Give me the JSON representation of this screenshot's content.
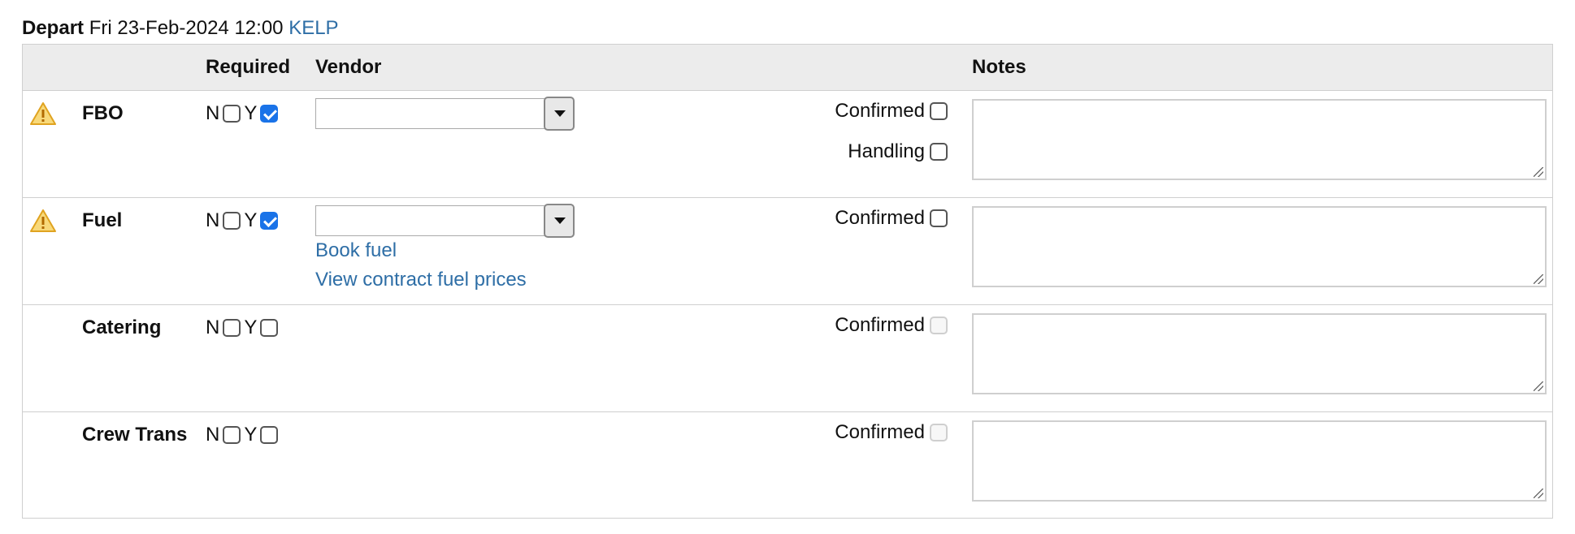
{
  "header": {
    "label": "Depart",
    "datetime": "Fri 23-Feb-2024 12:00",
    "airport": "KELP"
  },
  "columns": {
    "required": "Required",
    "vendor": "Vendor",
    "notes": "Notes"
  },
  "rows": [
    {
      "service": "FBO",
      "warning": true,
      "n_label": "N",
      "y_label": "Y",
      "n_checked": false,
      "y_checked": true,
      "vendor_select": true,
      "links": [],
      "confirmed_label": "Confirmed",
      "confirmed_enabled": true,
      "handling_label": "Handling",
      "notes": ""
    },
    {
      "service": "Fuel",
      "warning": true,
      "n_label": "N",
      "y_label": "Y",
      "n_checked": false,
      "y_checked": true,
      "vendor_select": true,
      "links": [
        "Book fuel",
        "View contract fuel prices"
      ],
      "confirmed_label": "Confirmed",
      "confirmed_enabled": true,
      "notes": ""
    },
    {
      "service": "Catering",
      "warning": false,
      "n_label": "N",
      "y_label": "Y",
      "n_checked": false,
      "y_checked": false,
      "vendor_select": false,
      "links": [],
      "confirmed_label": "Confirmed",
      "confirmed_enabled": false,
      "notes": ""
    },
    {
      "service": "Crew Trans",
      "warning": false,
      "n_label": "N",
      "y_label": "Y",
      "n_checked": false,
      "y_checked": false,
      "vendor_select": false,
      "links": [],
      "confirmed_label": "Confirmed",
      "confirmed_enabled": false,
      "notes": ""
    }
  ],
  "colors": {
    "link": "#2e6ea6",
    "checkbox_checked": "#1a73e8",
    "warning": "#f0b429",
    "header_bg": "#ececec"
  },
  "icons": {
    "warning": "warning-triangle-icon",
    "dropdown": "chevron-down-icon"
  }
}
